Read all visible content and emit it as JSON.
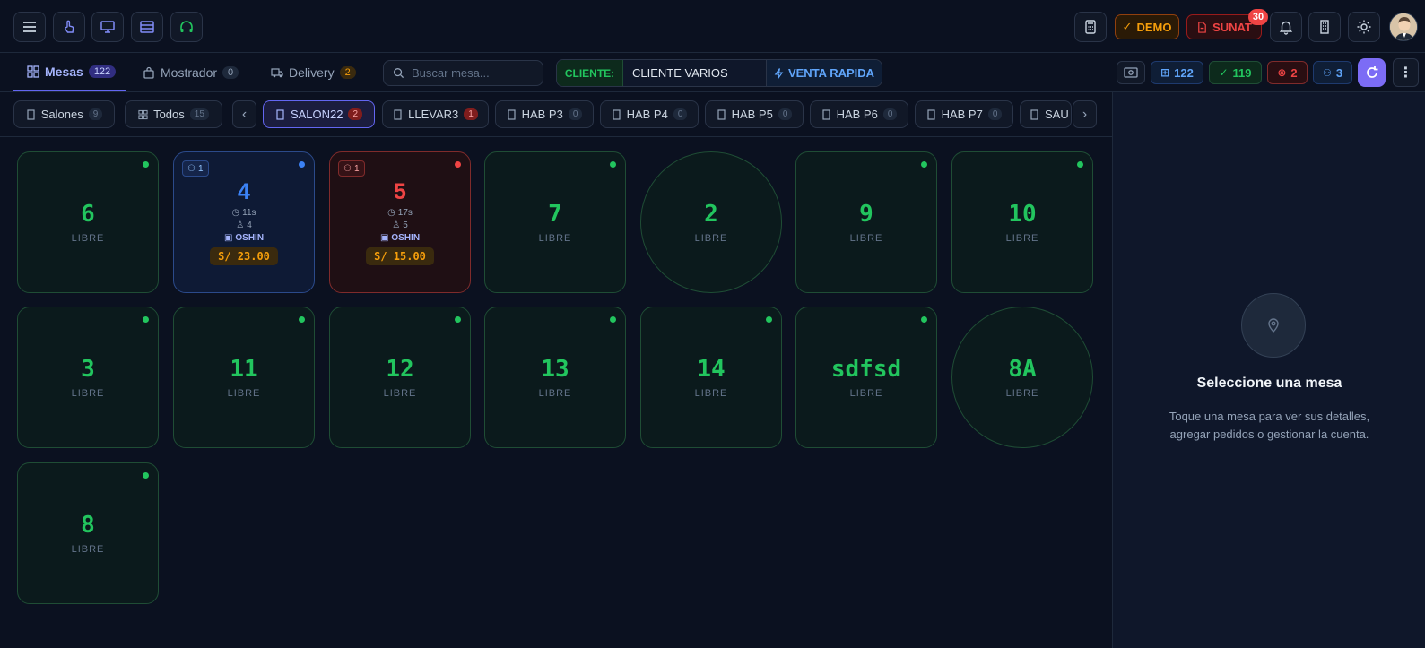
{
  "header": {
    "demo": "DEMO",
    "sunat": "SUNAT",
    "sunat_badge": "30"
  },
  "nav": {
    "tabs": [
      {
        "label": "Mesas",
        "count": "122"
      },
      {
        "label": "Mostrador",
        "count": "0"
      },
      {
        "label": "Delivery",
        "count": "2"
      }
    ],
    "search_placeholder": "Buscar mesa...",
    "cliente_label": "CLIENTE:",
    "cliente_value": "CLIENTE VARIOS",
    "venta_rapida": "VENTA RAPIDA",
    "stats": {
      "total": "122",
      "free": "119",
      "occupied": "2",
      "people": "3"
    }
  },
  "filters": {
    "salones": {
      "label": "Salones",
      "count": "9"
    },
    "todos": {
      "label": "Todos",
      "count": "15"
    },
    "rooms": [
      {
        "label": "SALON22",
        "count": "2"
      },
      {
        "label": "LLEVAR3",
        "count": "1"
      },
      {
        "label": "HAB P3",
        "count": "0"
      },
      {
        "label": "HAB P4",
        "count": "0"
      },
      {
        "label": "HAB P5",
        "count": "0"
      },
      {
        "label": "HAB P6",
        "count": "0"
      },
      {
        "label": "HAB P7",
        "count": "0"
      },
      {
        "label": "SAU",
        "count": ""
      }
    ]
  },
  "tables": [
    {
      "num": "6",
      "status": "LIBRE"
    },
    {
      "num": "4",
      "people_tag": "1",
      "time": "11s",
      "guests": "4",
      "waiter": "OSHIN",
      "total": "S/ 23.00"
    },
    {
      "num": "5",
      "people_tag": "1",
      "time": "17s",
      "guests": "5",
      "waiter": "OSHIN",
      "total": "S/ 15.00"
    },
    {
      "num": "7",
      "status": "LIBRE"
    },
    {
      "num": "2",
      "status": "LIBRE"
    },
    {
      "num": "9",
      "status": "LIBRE"
    },
    {
      "num": "10",
      "status": "LIBRE"
    },
    {
      "num": "3",
      "status": "LIBRE"
    },
    {
      "num": "11",
      "status": "LIBRE"
    },
    {
      "num": "12",
      "status": "LIBRE"
    },
    {
      "num": "13",
      "status": "LIBRE"
    },
    {
      "num": "14",
      "status": "LIBRE"
    },
    {
      "num": "sdfsd",
      "status": "LIBRE"
    },
    {
      "num": "8A",
      "status": "LIBRE"
    },
    {
      "num": "8",
      "status": "LIBRE"
    }
  ],
  "panel": {
    "title": "Seleccione una mesa",
    "description": "Toque una mesa para ver sus detalles, agregar pedidos o gestionar la cuenta."
  }
}
